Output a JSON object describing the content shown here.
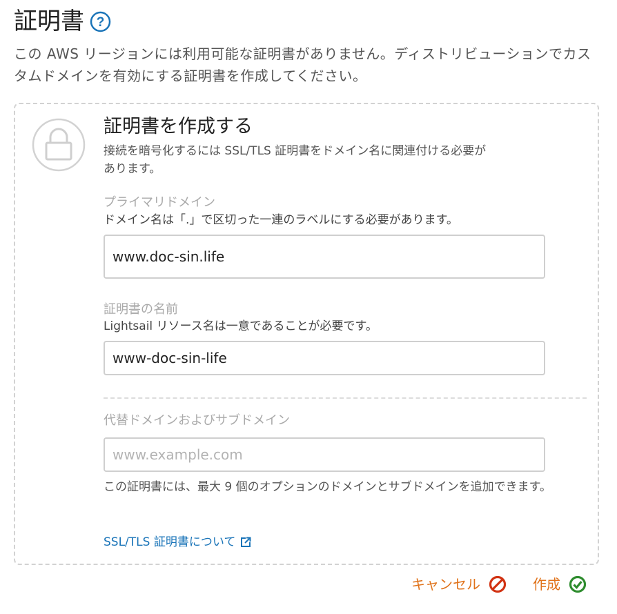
{
  "header": {
    "title": "証明書",
    "help_icon": "question-circle-icon"
  },
  "intro": "この AWS リージョンには利用可能な証明書がありません。ディストリビューションでカスタムドメインを有効にする証明書を作成してください。",
  "card": {
    "icon": "lock-icon",
    "title": "証明書を作成する",
    "description": "接続を暗号化するには SSL/TLS 証明書をドメイン名に関連付ける必要があります。",
    "primary_domain": {
      "label": "プライマリドメイン",
      "hint": "ドメイン名は「.」で区切った一連のラベルにする必要があります。",
      "value": "www.doc-sin.life"
    },
    "certificate_name": {
      "label": "証明書の名前",
      "hint": "Lightsail リソース名は一意であることが必要です。",
      "value": "www-doc-sin-life"
    },
    "alternate_domains": {
      "label": "代替ドメインおよびサブドメイン",
      "placeholder": "www.example.com",
      "value": ""
    },
    "note": "この証明書には、最大 9 個のオプションのドメインとサブドメインを追加できます。",
    "link": {
      "label": "SSL/TLS 証明書について",
      "icon": "external-link-icon"
    }
  },
  "actions": {
    "cancel_label": "キャンセル",
    "cancel_icon": "cancel-circle-icon",
    "create_label": "作成",
    "create_icon": "check-circle-icon"
  },
  "colors": {
    "accent_orange": "#e0731b",
    "link_blue": "#1a74b8",
    "help_blue": "#1a74b8",
    "cancel_red": "#d13212",
    "confirm_green": "#2e8c2e"
  }
}
